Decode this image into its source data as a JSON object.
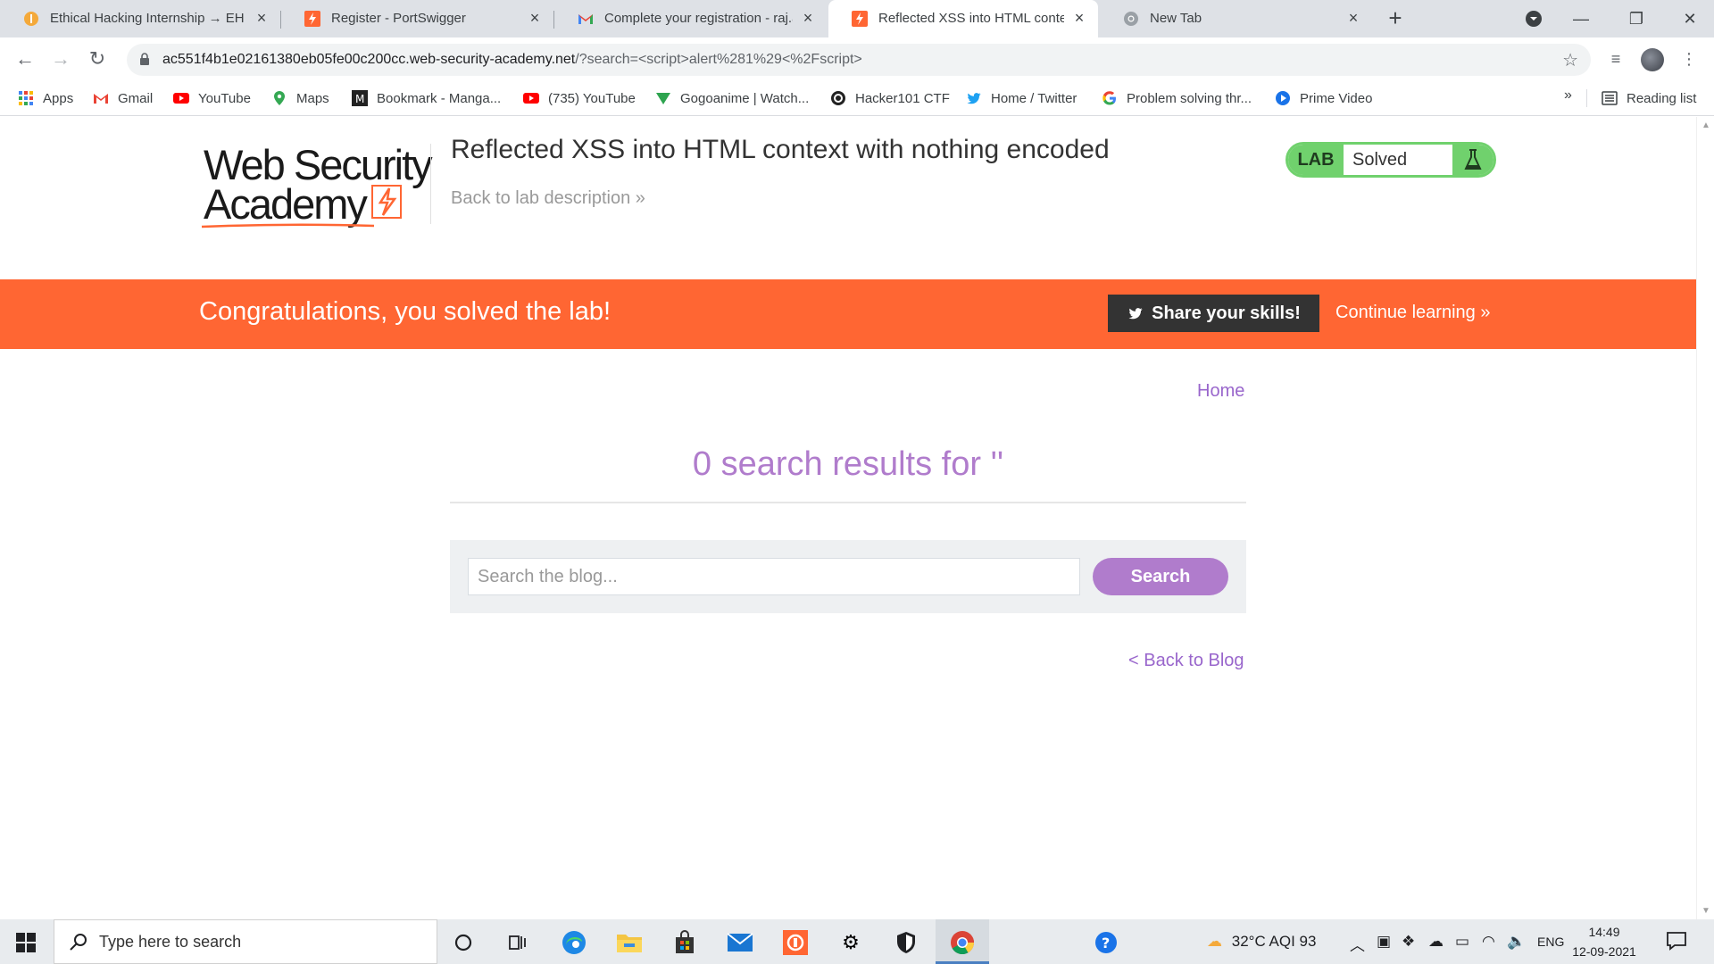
{
  "browser": {
    "tabs": [
      {
        "title": "Ethical Hacking Internship → EH ...",
        "active": false
      },
      {
        "title": "Register - PortSwigger",
        "active": false
      },
      {
        "title": "Complete your registration - raj.a...",
        "active": false
      },
      {
        "title": "Reflected XSS into HTML context",
        "active": true
      },
      {
        "title": "New Tab",
        "active": false
      }
    ],
    "url_host": "ac551f4b1e02161380eb05fe00c200cc.web-security-academy.net",
    "url_path": "/?search=<script>alert%281%29<%2Fscript>",
    "bookmarks": [
      {
        "label": "Apps",
        "icon": "apps-grid-icon"
      },
      {
        "label": "Gmail",
        "icon": "gmail-icon"
      },
      {
        "label": "YouTube",
        "icon": "youtube-icon"
      },
      {
        "label": "Maps",
        "icon": "maps-icon"
      },
      {
        "label": "Bookmark - Manga...",
        "icon": "manga-icon"
      },
      {
        "label": "(735) YouTube",
        "icon": "youtube-icon"
      },
      {
        "label": "Gogoanime | Watch...",
        "icon": "gogoanime-icon"
      },
      {
        "label": "Hacker101 CTF",
        "icon": "hacker101-icon"
      },
      {
        "label": "Home / Twitter",
        "icon": "twitter-icon"
      },
      {
        "label": "Problem solving thr...",
        "icon": "google-icon"
      },
      {
        "label": "Prime Video",
        "icon": "prime-video-icon"
      }
    ],
    "bookmarks_more": "»",
    "reading_list": "Reading list"
  },
  "page": {
    "logo_line1": "Web Security",
    "logo_line2": "Academy",
    "lab_title": "Reflected XSS into HTML context with nothing encoded",
    "back_to_description": "Back to lab description",
    "lab_badge": "LAB",
    "lab_status": "Solved",
    "banner_message": "Congratulations, you solved the lab!",
    "share_label": "Share your skills!",
    "continue_label": "Continue learning",
    "home_link": "Home",
    "results_heading": "0 search results for ''",
    "search_placeholder": "Search the blog...",
    "search_button": "Search",
    "back_to_blog": "< Back to Blog"
  },
  "taskbar": {
    "search_placeholder": "Type here to search",
    "weather": "32°C  AQI 93",
    "language": "ENG",
    "time": "14:49",
    "date": "12-09-2021"
  },
  "colors": {
    "brand_orange": "#ff6633",
    "lab_green": "#70d16d",
    "link_purple": "#9966cc",
    "heading_purple": "#b07ccc",
    "share_dark": "#333333"
  }
}
